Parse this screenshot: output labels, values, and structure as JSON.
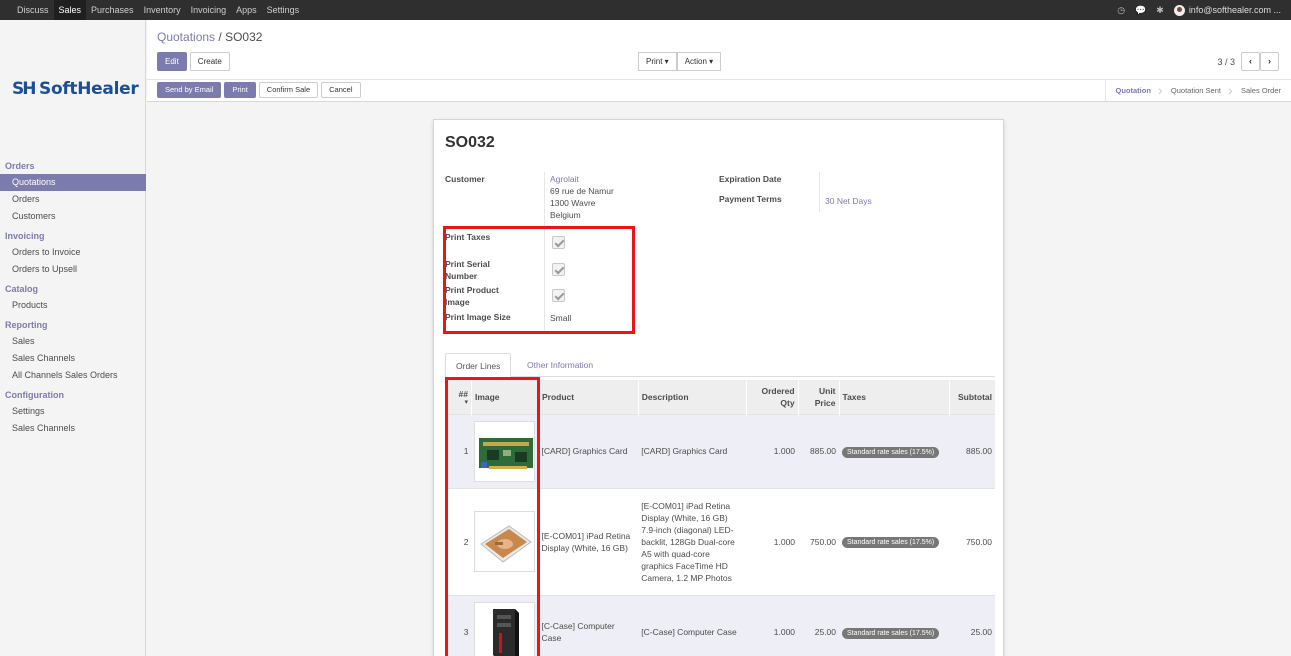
{
  "topbar": {
    "menu": [
      "Discuss",
      "Sales",
      "Purchases",
      "Inventory",
      "Invoicing",
      "Apps",
      "Settings"
    ],
    "active": "Sales",
    "user": "info@softhealer.com ..."
  },
  "logo": {
    "text_a": "Soft",
    "text_b": "Healer"
  },
  "sidebar": {
    "sections": [
      {
        "title": "Orders",
        "items": [
          "Quotations",
          "Orders",
          "Customers"
        ]
      },
      {
        "title": "Invoicing",
        "items": [
          "Orders to Invoice",
          "Orders to Upsell"
        ]
      },
      {
        "title": "Catalog",
        "items": [
          "Products"
        ]
      },
      {
        "title": "Reporting",
        "items": [
          "Sales",
          "Sales Channels",
          "All Channels Sales Orders"
        ]
      },
      {
        "title": "Configuration",
        "items": [
          "Settings",
          "Sales Channels"
        ]
      }
    ],
    "active_item": "Quotations"
  },
  "control": {
    "breadcrumb_parent": "Quotations",
    "breadcrumb_sep": "/",
    "breadcrumb_current": "SO032",
    "edit": "Edit",
    "create": "Create",
    "print_menu": "Print ▾",
    "action_menu": "Action ▾",
    "pager": "3 / 3",
    "prev": "‹",
    "next": "›",
    "send_email": "Send by Email",
    "print": "Print",
    "confirm": "Confirm Sale",
    "cancel": "Cancel",
    "status": [
      "Quotation",
      "Quotation Sent",
      "Sales Order"
    ]
  },
  "form": {
    "title": "SO032",
    "customer_label": "Customer",
    "customer_name": "Agrolait",
    "address1": "69 rue de Namur",
    "address2": "1300 Wavre",
    "country": "Belgium",
    "expiration_label": "Expiration Date",
    "payment_label": "Payment Terms",
    "payment_value": "30 Net Days",
    "print_taxes_label": "Print Taxes",
    "print_serial_label_1": "Print Serial",
    "print_serial_label_2": "Number",
    "print_image_label_1": "Print Product",
    "print_image_label_2": "Image",
    "print_size_label": "Print Image Size",
    "print_size_value": "Small"
  },
  "tabs": {
    "order_lines": "Order Lines",
    "other": "Other Information"
  },
  "table": {
    "headers": {
      "seq": "##",
      "image": "Image",
      "product": "Product",
      "description": "Description",
      "qty_1": "Ordered",
      "qty_2": "Qty",
      "price_1": "Unit",
      "price_2": "Price",
      "taxes": "Taxes",
      "subtotal": "Subtotal"
    },
    "rows": [
      {
        "seq": "1",
        "product": "[CARD] Graphics Card",
        "description": "[CARD] Graphics Card",
        "qty": "1.000",
        "price": "885.00",
        "tax": "Standard rate sales (17.5%)",
        "subtotal": "885.00"
      },
      {
        "seq": "2",
        "product": "[E-COM01] iPad Retina Display (White, 16 GB)",
        "description": "[E-COM01] iPad Retina Display (White, 16 GB) 7.9-inch (diagonal) LED-backlit, 128Gb Dual-core A5 with quad-core graphics FaceTime HD Camera, 1.2 MP Photos",
        "qty": "1.000",
        "price": "750.00",
        "tax": "Standard rate sales (17.5%)",
        "subtotal": "750.00"
      },
      {
        "seq": "3",
        "product": "[C-Case] Computer Case",
        "description": "[C-Case] Computer Case",
        "qty": "1.000",
        "price": "25.00",
        "tax": "Standard rate sales (17.5%)",
        "subtotal": "25.00"
      }
    ]
  },
  "colors": {
    "accent": "#7c7bad",
    "highlight_box": "#e8151b",
    "topbar": "#2f2f2f"
  },
  "icons": [
    "clock-icon",
    "chat-icon",
    "bug-icon",
    "avatar",
    "sort-caret-icon"
  ]
}
